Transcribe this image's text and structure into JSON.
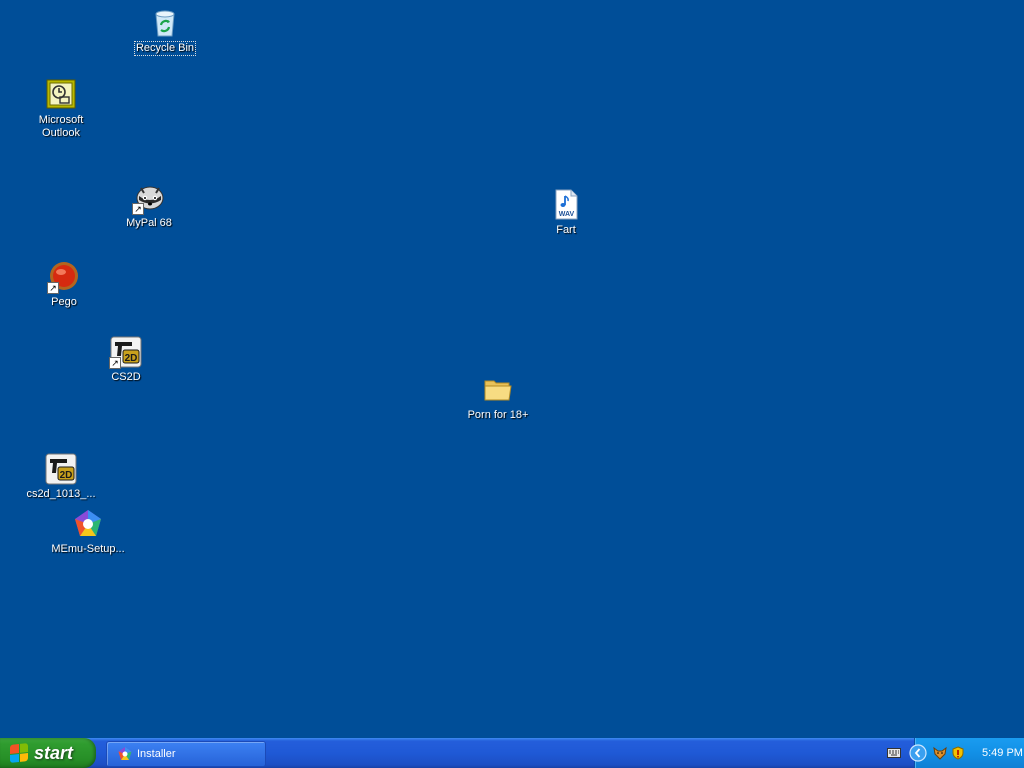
{
  "desktop": {
    "background": "#004E98",
    "icons": [
      {
        "label": "Recycle Bin"
      },
      {
        "label": "Microsoft\nOutlook"
      },
      {
        "label": "MyPal 68"
      },
      {
        "label": "Fart"
      },
      {
        "label": "Pego"
      },
      {
        "label": "CS2D"
      },
      {
        "label": "Porn for 18+"
      },
      {
        "label": "cs2d_1013_..."
      },
      {
        "label": "MEmu-Setup..."
      }
    ],
    "wav_badge": "WAV",
    "cs2d_badge": "2D",
    "shortcut_arrow": "↗"
  },
  "taskbar": {
    "start_label": "start",
    "tasks": [
      {
        "label": "Installer"
      }
    ]
  },
  "tray": {
    "clock": "5:49 PM",
    "icons": [
      "keyboard-icon",
      "chevron-left-icon",
      "fox-icon",
      "security-shield-icon"
    ]
  }
}
